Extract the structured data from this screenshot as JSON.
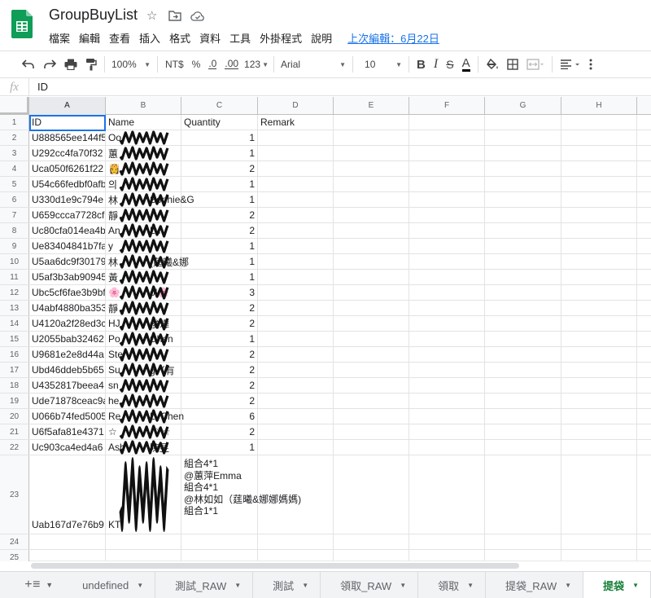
{
  "doc": {
    "title": "GroupBuyList",
    "star_icon": "star-icon",
    "move_icon": "folder-move-icon",
    "cloud_icon": "cloud-status-icon"
  },
  "menu": [
    "檔案",
    "編輯",
    "查看",
    "插入",
    "格式",
    "資料",
    "工具",
    "外掛程式",
    "說明"
  ],
  "last_edit": "上次編輯：6月22日",
  "toolbar": {
    "zoom": "100%",
    "currency": "NT$",
    "percent": "%",
    "dec_less": ".0",
    "dec_more": ".00",
    "more_formats": "123",
    "font": "Arial",
    "font_size": "10",
    "bold": "B",
    "italic": "I",
    "strike": "S",
    "text_color": "A"
  },
  "formula": {
    "fx": "fx",
    "value": "ID"
  },
  "columns": [
    "A",
    "B",
    "C",
    "D",
    "E",
    "F",
    "G",
    "H"
  ],
  "selected_column": "A",
  "rows": [
    {
      "n": "1",
      "a": "ID",
      "b": "Name",
      "c": "Quantity",
      "d": "Remark"
    },
    {
      "n": "2",
      "a": "U888565ee144f5",
      "b": "Oo",
      "c": "1"
    },
    {
      "n": "3",
      "a": "U292cc4fa70f32",
      "b": "蕙",
      "c": "1"
    },
    {
      "n": "4",
      "a": "Uca050f6261f22",
      "b": "👸",
      "c": "2"
    },
    {
      "n": "5",
      "a": "U54c66fedbf0afb",
      "b": "의",
      "c": "1"
    },
    {
      "n": "6",
      "a": "U330d1e9c794e",
      "b": "林",
      "c": "1",
      "b_tail": "Sophie&G"
    },
    {
      "n": "7",
      "a": "U659ccca7728cf",
      "b": "靜",
      "c": "2"
    },
    {
      "n": "8",
      "a": "Uc80cfa014ea4b",
      "b": "An",
      "c": "2",
      "b_tail": "Lu"
    },
    {
      "n": "9",
      "a": "Ue83404841b7fa",
      "b": "y",
      "c": "1"
    },
    {
      "n": "10",
      "a": "U5aa6dc9f30179",
      "b": "林",
      "c": "1",
      "b_tail": "(莛曦&娜"
    },
    {
      "n": "11",
      "a": "U5af3b3ab90945",
      "b": "黃",
      "c": "1"
    },
    {
      "n": "12",
      "a": "Ubc5cf6fae3b9bf",
      "b": "🌸",
      "c": "3",
      "b_tail": "ol🌸"
    },
    {
      "n": "13",
      "a": "U4abf4880ba353",
      "b": "靜",
      "c": "2"
    },
    {
      "n": "14",
      "a": "U4120a2f28ed3c",
      "b": "HJ",
      "c": "2",
      "b_tail": "俊瑋"
    },
    {
      "n": "15",
      "a": "U2055bab32462",
      "b": "Po",
      "c": "1",
      "b_tail": "Chen"
    },
    {
      "n": "16",
      "a": "U9681e2e8d44a",
      "b": "Ste",
      "c": "2"
    },
    {
      "n": "17",
      "a": "Ubd46ddeb5b65",
      "b": "Su",
      "c": "2",
      "b_tail": "g（有"
    },
    {
      "n": "18",
      "a": "U4352817beea4",
      "b": "sn",
      "c": "2"
    },
    {
      "n": "19",
      "a": "Ude71878ceac9a",
      "b": "he",
      "c": "2"
    },
    {
      "n": "20",
      "a": "U066b74fed5005",
      "b": "Re",
      "c": "6",
      "b_tail": "L. Chen"
    },
    {
      "n": "21",
      "a": "U6f5afa81e4371",
      "b": "☆",
      "c": "2",
      "b_tail": "-♡☆"
    },
    {
      "n": "22",
      "a": "Uc903ca4ed4a6",
      "b": "Ash",
      "c": "1",
      "b_tail": "陳昱"
    },
    {
      "n": "23",
      "a": "Uab167d7e76b9",
      "b": "KT",
      "c": "",
      "remark": "組合4*1\n@蕙萍Emma\n組合4*1\n@林如如（莛曦&娜娜媽媽)\n組合1*1"
    },
    {
      "n": "24",
      "a": "",
      "b": "",
      "c": ""
    },
    {
      "n": "25",
      "a": "",
      "b": "",
      "c": ""
    }
  ],
  "sheet_tabs": [
    "undefined",
    "測試_RAW",
    "測試",
    "領取_RAW",
    "領取",
    "提袋_RAW",
    "提袋"
  ],
  "active_tab": "提袋",
  "colors": {
    "accent": "#1a73e8",
    "active_tab": "#188038",
    "sheets_green": "#0f9d58"
  }
}
